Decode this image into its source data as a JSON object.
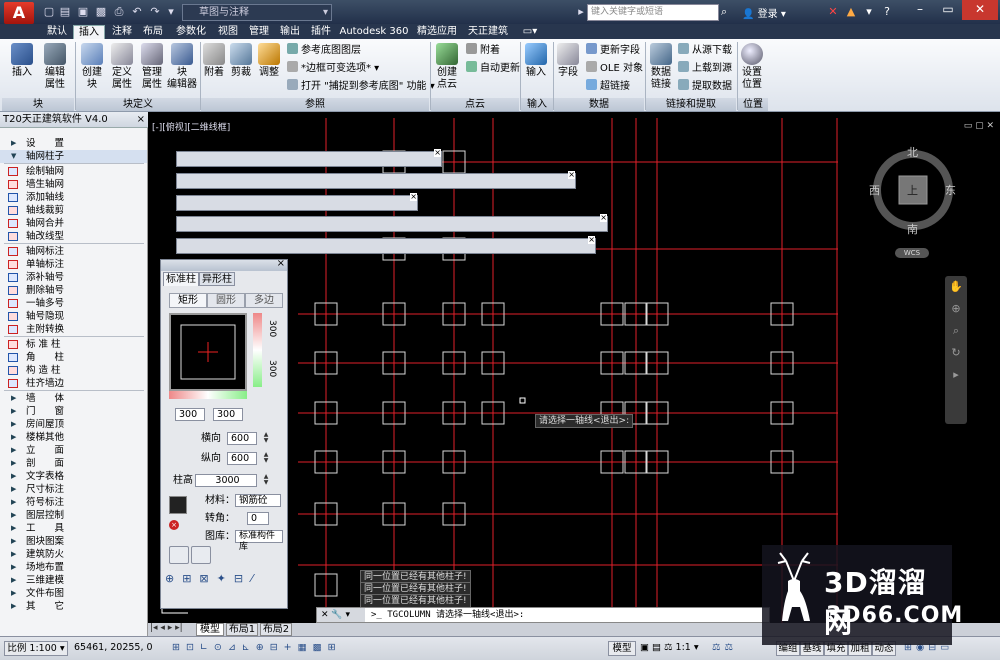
{
  "titlebar": {
    "workspace": "草图与注释",
    "search_placeholder": "键入关键字或短语",
    "user": "登录",
    "app_letter": "A"
  },
  "tabs": [
    "默认",
    "插入",
    "注释",
    "布局",
    "参数化",
    "视图",
    "管理",
    "输出",
    "插件",
    "Autodesk 360",
    "精选应用",
    "天正建筑"
  ],
  "active_tab": "插入",
  "ribbon": {
    "block": {
      "label": "块",
      "items": [
        "插入",
        "编辑\n属性"
      ]
    },
    "blockdef": {
      "label": "块定义",
      "items": [
        "创建\n块",
        "定义\n属性",
        "管理\n属性",
        "块\n编辑器"
      ]
    },
    "ref": {
      "label": "参照",
      "items": [
        "附着",
        "剪裁",
        "调整"
      ],
      "small": [
        "参考底图图层",
        "*边框可变选项*",
        "打开 \"捕捉到参考底图\" 功能"
      ]
    },
    "pointcloud": {
      "label": "点云",
      "items": [
        "创建\n点云"
      ],
      "small": [
        "附着",
        "自动更新"
      ]
    },
    "import": {
      "label": "输入",
      "items": [
        "输入"
      ]
    },
    "data": {
      "label": "数据",
      "items": [
        "字段"
      ],
      "small": [
        "更新字段",
        "OLE 对象",
        "超链接"
      ]
    },
    "link": {
      "label": "链接和提取",
      "items": [
        "数据\n链接"
      ],
      "small": [
        "从源下载",
        "上载到源",
        "提取数据"
      ]
    },
    "location": {
      "label": "位置",
      "items": [
        "设置\n位置"
      ]
    }
  },
  "leftpanel": {
    "title": "T20天正建筑软件 V4.0",
    "items": [
      {
        "t": "设　　置",
        "k": "tri"
      },
      {
        "t": "轴网柱子",
        "k": "open"
      },
      {
        "t": "绘制轴网",
        "k": "ic"
      },
      {
        "t": "墙生轴网",
        "k": "ic"
      },
      {
        "t": "添加轴线",
        "k": "ic"
      },
      {
        "t": "轴线裁剪",
        "k": "ic"
      },
      {
        "t": "轴网合并",
        "k": "ic"
      },
      {
        "t": "轴改线型",
        "k": "ic"
      },
      {
        "t": "轴网标注",
        "k": "ic"
      },
      {
        "t": "单轴标注",
        "k": "ic"
      },
      {
        "t": "添补轴号",
        "k": "ic"
      },
      {
        "t": "删除轴号",
        "k": "ic"
      },
      {
        "t": "一轴多号",
        "k": "ic"
      },
      {
        "t": "轴号隐现",
        "k": "ic"
      },
      {
        "t": "主附转换",
        "k": "ic"
      },
      {
        "t": "标 准 柱",
        "k": "ic"
      },
      {
        "t": "角　　柱",
        "k": "ic"
      },
      {
        "t": "构 造 柱",
        "k": "ic"
      },
      {
        "t": "柱齐墙边",
        "k": "ic"
      },
      {
        "t": "墙　　体",
        "k": "tri"
      },
      {
        "t": "门　　窗",
        "k": "tri"
      },
      {
        "t": "房间屋顶",
        "k": "tri"
      },
      {
        "t": "楼梯其他",
        "k": "tri"
      },
      {
        "t": "立　　面",
        "k": "tri"
      },
      {
        "t": "剖　　面",
        "k": "tri"
      },
      {
        "t": "文字表格",
        "k": "tri"
      },
      {
        "t": "尺寸标注",
        "k": "tri"
      },
      {
        "t": "符号标注",
        "k": "tri"
      },
      {
        "t": "图层控制",
        "k": "tri"
      },
      {
        "t": "工　　具",
        "k": "tri"
      },
      {
        "t": "图块图案",
        "k": "tri"
      },
      {
        "t": "建筑防火",
        "k": "tri"
      },
      {
        "t": "场地布置",
        "k": "tri"
      },
      {
        "t": "三维建模",
        "k": "tri"
      },
      {
        "t": "文件布图",
        "k": "tri"
      },
      {
        "t": "其　　它",
        "k": "tri"
      }
    ]
  },
  "viewport": {
    "label": "[-][俯视][二维线框]",
    "compass": {
      "n": "北",
      "s": "南",
      "e": "东",
      "w": "西",
      "center": "上"
    },
    "wcs": "WCS"
  },
  "column_panel": {
    "tabs": [
      "标准柱",
      "异形柱"
    ],
    "shape_tabs": [
      "矩形",
      "圆形",
      "多边"
    ],
    "dim_h": "300",
    "dim_v": "300",
    "size_a": "300",
    "size_b": "300",
    "x_label": "横向",
    "x_value": "600",
    "y_label": "纵向",
    "y_value": "600",
    "height_label": "柱高",
    "height_value": "3000",
    "material_label": "材料：",
    "material_value": "钢筋砼",
    "angle_label": "转角：",
    "angle_value": "0",
    "lib_label": "图库：",
    "lib_value": "标准构件库"
  },
  "tooltip": "请选择一轴线<退出>:",
  "history": [
    "同一位置已经有其他柱子!",
    "同一位置已经有其他柱子!",
    "同一位置已经有其他柱子!"
  ],
  "command": "TGCOLUMN 请选择一轴线<退出>:",
  "layout_tabs": [
    "模型",
    "布局1",
    "布局2"
  ],
  "status": {
    "scale": "比例 1:100",
    "coords": "65461, 20255, 0",
    "model": "模型",
    "anno_scale": "1:1",
    "buttons": [
      "编组",
      "基线",
      "填充",
      "加粗",
      "动态"
    ]
  },
  "watermark": {
    "line1": "3D溜溜网",
    "line2": "3D66.COM"
  },
  "colors": {
    "grid": "#e0202a",
    "column": "#d8d8d8",
    "accent": "#c0201a",
    "tab_bg": "#28364e"
  }
}
